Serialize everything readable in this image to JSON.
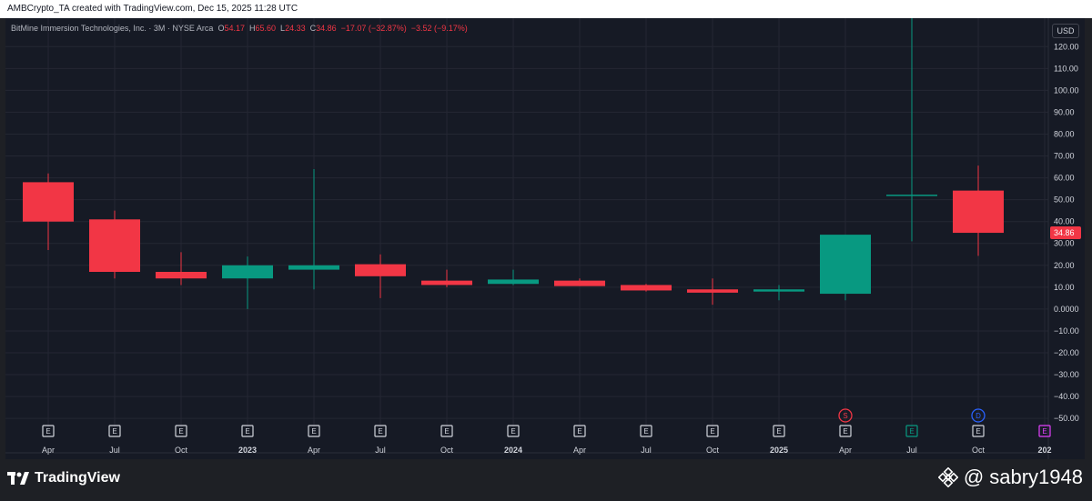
{
  "header": {
    "attribution": "AMBCrypto_TA created with TradingView.com, Dec 15, 2025 11:28 UTC"
  },
  "legend": {
    "symbol": "BitMine Immersion Technologies, Inc. · 3M · NYSE Arca",
    "o_label": "O",
    "o_value": "54.17",
    "h_label": "H",
    "h_value": "65.60",
    "l_label": "L",
    "l_value": "24.33",
    "c_label": "C",
    "c_value": "34.86",
    "change": "−17.07 (−32.87%)",
    "change2": "−3.52 (−9.17%)"
  },
  "currency": "USD",
  "colors": {
    "up": "#089981",
    "down": "#f23645",
    "background": "#161a25",
    "grid": "#242733",
    "text": "#d1d4dc"
  },
  "chart_data": {
    "type": "candlestick",
    "y_range": [
      -57,
      133
    ],
    "y_ticks": [
      -50,
      -40,
      -30,
      -20,
      -10,
      0,
      10,
      20,
      30,
      40,
      50,
      60,
      70,
      80,
      90,
      100,
      110,
      120
    ],
    "y_tick_labels": [
      "−50.00",
      "−40.00",
      "−30.00",
      "−20.00",
      "−10.00",
      "0.0000",
      "10.00",
      "20.00",
      "30.00",
      "40.00",
      "50.00",
      "60.00",
      "70.00",
      "80.00",
      "90.00",
      "100.00",
      "110.00",
      "120.00"
    ],
    "x_labels": [
      "Apr",
      "Jul",
      "Oct",
      "2023",
      "Apr",
      "Jul",
      "Oct",
      "2024",
      "Apr",
      "Jul",
      "Oct",
      "2025",
      "Apr",
      "Jul",
      "Oct",
      "202"
    ],
    "x_bold": [
      false,
      false,
      false,
      true,
      false,
      false,
      false,
      true,
      false,
      false,
      false,
      true,
      false,
      false,
      false,
      true
    ],
    "candles": [
      {
        "o": 58,
        "h": 62,
        "l": 27,
        "c": 40
      },
      {
        "o": 41,
        "h": 45,
        "l": 14,
        "c": 17
      },
      {
        "o": 17,
        "h": 26,
        "l": 11,
        "c": 14
      },
      {
        "o": 14,
        "h": 24,
        "l": 0,
        "c": 20
      },
      {
        "o": 18,
        "h": 64,
        "l": 9,
        "c": 20
      },
      {
        "o": 20.5,
        "h": 25,
        "l": 5,
        "c": 15
      },
      {
        "o": 13,
        "h": 18,
        "l": 10,
        "c": 11
      },
      {
        "o": 11.5,
        "h": 18,
        "l": 11,
        "c": 13.5
      },
      {
        "o": 13,
        "h": 14,
        "l": 10.5,
        "c": 10.5
      },
      {
        "o": 11,
        "h": 11.5,
        "l": 8,
        "c": 8.5
      },
      {
        "o": 9,
        "h": 14,
        "l": 2,
        "c": 7.5
      },
      {
        "o": 8,
        "h": 11,
        "l": 4,
        "c": 9
      },
      {
        "o": 7,
        "h": 34,
        "l": 4,
        "c": 34
      },
      {
        "o": 52,
        "h": 135,
        "l": 31,
        "c": 52.3
      },
      {
        "o": 54.17,
        "h": 65.6,
        "l": 24.33,
        "c": 34.86
      }
    ],
    "last_price_label": "34.86",
    "last_price": 34.86,
    "event_markers": [
      {
        "label": "E",
        "kind": "earnings",
        "color": "#d1d4dc"
      },
      {
        "label": "E",
        "kind": "earnings",
        "color": "#d1d4dc"
      },
      {
        "label": "E",
        "kind": "earnings",
        "color": "#d1d4dc"
      },
      {
        "label": "E",
        "kind": "earnings",
        "color": "#d1d4dc"
      },
      {
        "label": "E",
        "kind": "earnings",
        "color": "#d1d4dc"
      },
      {
        "label": "E",
        "kind": "earnings",
        "color": "#d1d4dc"
      },
      {
        "label": "E",
        "kind": "earnings",
        "color": "#d1d4dc"
      },
      {
        "label": "E",
        "kind": "earnings",
        "color": "#d1d4dc"
      },
      {
        "label": "E",
        "kind": "earnings",
        "color": "#d1d4dc"
      },
      {
        "label": "E",
        "kind": "earnings",
        "color": "#d1d4dc"
      },
      {
        "label": "E",
        "kind": "earnings",
        "color": "#d1d4dc"
      },
      {
        "label": "E",
        "kind": "earnings",
        "color": "#d1d4dc"
      },
      {
        "label": "E",
        "kind": "earnings",
        "color": "#d1d4dc"
      },
      {
        "label": "E",
        "kind": "earnings",
        "color": "#089981"
      },
      {
        "label": "E",
        "kind": "earnings",
        "color": "#d1d4dc"
      },
      {
        "label": "E",
        "kind": "earnings",
        "color": "#e040fb"
      }
    ],
    "special_markers": [
      {
        "label": "S",
        "color": "#f23645",
        "x_index": 12
      },
      {
        "label": "D",
        "color": "#2962ff",
        "x_index": 14
      }
    ]
  },
  "branding": {
    "tv_name": "TradingView",
    "watermark": "@ sabry1948"
  }
}
